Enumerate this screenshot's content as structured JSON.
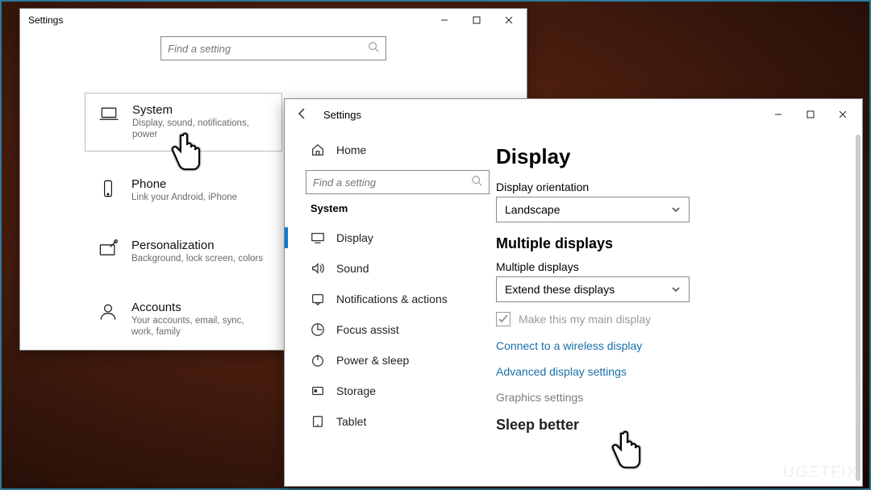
{
  "win1": {
    "title": "Settings",
    "search_placeholder": "Find a setting",
    "categories": [
      {
        "key": "system",
        "title": "System",
        "desc": "Display, sound, notifications, power",
        "selected": true
      },
      {
        "key": "phone",
        "title": "Phone",
        "desc": "Link your Android, iPhone"
      },
      {
        "key": "personalization",
        "title": "Personalization",
        "desc": "Background, lock screen, colors"
      },
      {
        "key": "accounts",
        "title": "Accounts",
        "desc": "Your accounts, email, sync, work, family"
      }
    ]
  },
  "win2": {
    "title": "Settings",
    "home_label": "Home",
    "search_placeholder": "Find a setting",
    "section_label": "System",
    "nav": [
      {
        "key": "display",
        "label": "Display",
        "active": true
      },
      {
        "key": "sound",
        "label": "Sound"
      },
      {
        "key": "notifications",
        "label": "Notifications & actions"
      },
      {
        "key": "focus",
        "label": "Focus assist"
      },
      {
        "key": "power",
        "label": "Power & sleep"
      },
      {
        "key": "storage",
        "label": "Storage"
      },
      {
        "key": "tablet",
        "label": "Tablet"
      }
    ],
    "content": {
      "page_title": "Display",
      "orientation_label": "Display orientation",
      "orientation_value": "Landscape",
      "multidisplays_heading": "Multiple displays",
      "multidisplays_label": "Multiple displays",
      "multidisplays_value": "Extend these displays",
      "main_display_checkbox": "Make this my main display",
      "link_wireless": "Connect to a wireless display",
      "link_advanced": "Advanced display settings",
      "link_graphics": "Graphics settings",
      "sleep_heading": "Sleep better"
    }
  },
  "watermark": "UGΞTFIX"
}
